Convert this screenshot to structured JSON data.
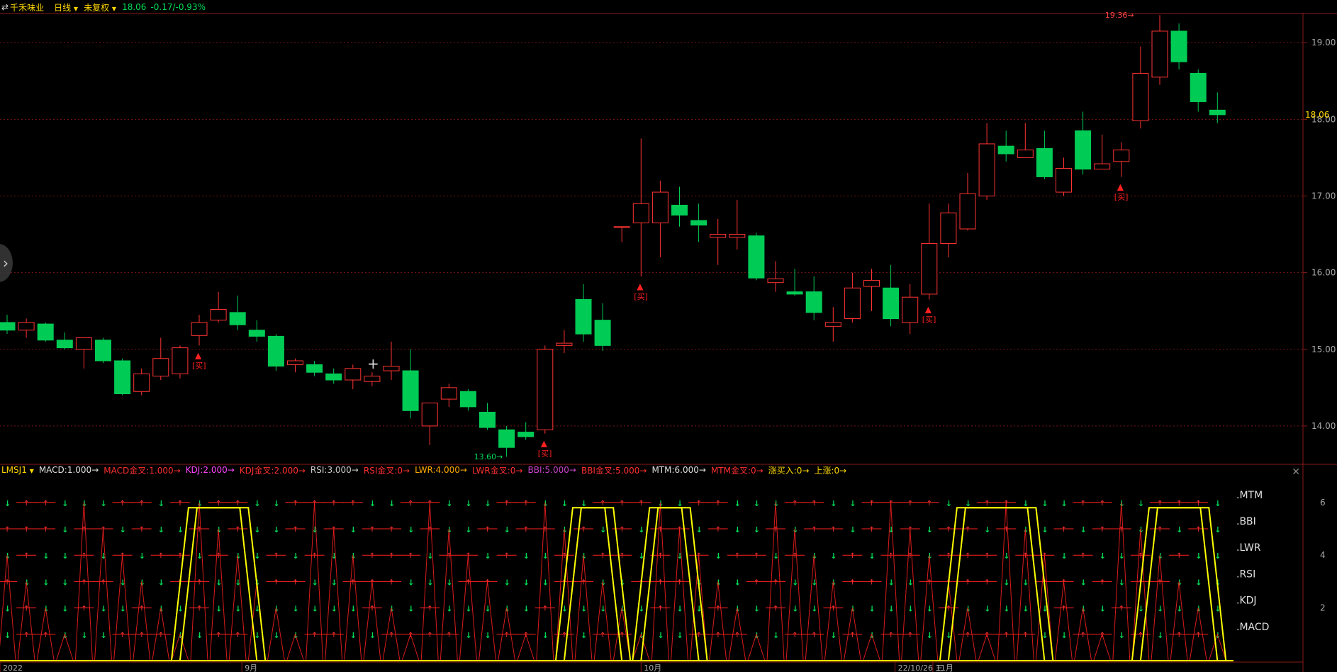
{
  "header": {
    "nav_icon": "reverse-arrows-icon",
    "stock_name": "千禾味业",
    "period": "日线",
    "adjust": "未复权",
    "price": "18.06",
    "change": "-0.17/-0.93%"
  },
  "indicator_bar": {
    "name": "LMSJ1",
    "items": [
      {
        "text": "MACD:1.000",
        "color": "#e0e0e0"
      },
      {
        "text": "MACD金叉:1.000",
        "color": "#ff3030"
      },
      {
        "text": "KDJ:2.000",
        "color": "#ff44ff"
      },
      {
        "text": "KDJ金叉:2.000",
        "color": "#ff3030"
      },
      {
        "text": "RSI:3.000",
        "color": "#cccccc"
      },
      {
        "text": "RSI金叉:0",
        "color": "#ff3030"
      },
      {
        "text": "LWR:4.000",
        "color": "#ffaa00"
      },
      {
        "text": "LWR金叉:0",
        "color": "#ff3030"
      },
      {
        "text": "BBI:5.000",
        "color": "#cc44cc"
      },
      {
        "text": "BBI金叉:5.000",
        "color": "#ff3030"
      },
      {
        "text": "MTM:6.000",
        "color": "#e0e0e0"
      },
      {
        "text": "MTM金叉:0",
        "color": "#ff3030"
      },
      {
        "text": "涨买入:0",
        "color": "#ffd700"
      },
      {
        "text": "上涨:0",
        "color": "#ffd700"
      }
    ],
    "close_icon": "close-icon"
  },
  "colors": {
    "up": "#ff3333",
    "down": "#00cc55",
    "yellow": "#ffff00",
    "grid": "#7a1515"
  },
  "price_axis": {
    "ticks": [
      "19.00",
      "18.00",
      "17.00",
      "16.00",
      "15.00",
      "14.00"
    ],
    "current": "18.06"
  },
  "osc_axis": {
    "ticks": [
      "6",
      "4",
      "2"
    ]
  },
  "series_labels": [
    ".MTM",
    ".BBI",
    ".LWR",
    ".RSI",
    ".KDJ",
    ".MACD"
  ],
  "buy_label": "[买]",
  "extremes": {
    "high": "19.36",
    "low": "13.60"
  },
  "x_labels": [
    "2022",
    "9月",
    "10月",
    "22/10/26 三",
    "11月"
  ],
  "chart_data": {
    "type": "candlestick",
    "ylim": [
      13.5,
      19.45
    ],
    "candles": [
      {
        "o": 15.35,
        "h": 15.45,
        "l": 15.2,
        "c": 15.25
      },
      {
        "o": 15.25,
        "h": 15.4,
        "l": 15.15,
        "c": 15.35
      },
      {
        "o": 15.33,
        "h": 15.35,
        "l": 15.1,
        "c": 15.12
      },
      {
        "o": 15.12,
        "h": 15.22,
        "l": 15.0,
        "c": 15.02
      },
      {
        "o": 15.0,
        "h": 15.15,
        "l": 14.75,
        "c": 15.15
      },
      {
        "o": 15.12,
        "h": 15.15,
        "l": 14.82,
        "c": 14.85
      },
      {
        "o": 14.85,
        "h": 14.88,
        "l": 14.4,
        "c": 14.42
      },
      {
        "o": 14.45,
        "h": 14.75,
        "l": 14.4,
        "c": 14.68
      },
      {
        "o": 14.65,
        "h": 15.15,
        "l": 14.6,
        "c": 14.88
      },
      {
        "o": 14.68,
        "h": 15.05,
        "l": 14.62,
        "c": 15.02
      },
      {
        "o": 15.18,
        "h": 15.45,
        "l": 15.05,
        "c": 15.35
      },
      {
        "o": 15.38,
        "h": 15.75,
        "l": 15.35,
        "c": 15.52
      },
      {
        "o": 15.48,
        "h": 15.7,
        "l": 15.25,
        "c": 15.32
      },
      {
        "o": 15.25,
        "h": 15.38,
        "l": 15.1,
        "c": 15.17
      },
      {
        "o": 15.17,
        "h": 15.2,
        "l": 14.72,
        "c": 14.78
      },
      {
        "o": 14.8,
        "h": 14.88,
        "l": 14.7,
        "c": 14.85
      },
      {
        "o": 14.8,
        "h": 14.85,
        "l": 14.65,
        "c": 14.7
      },
      {
        "o": 14.68,
        "h": 14.75,
        "l": 14.55,
        "c": 14.6
      },
      {
        "o": 14.6,
        "h": 14.8,
        "l": 14.48,
        "c": 14.75
      },
      {
        "o": 14.58,
        "h": 14.7,
        "l": 14.52,
        "c": 14.65
      },
      {
        "o": 14.72,
        "h": 15.1,
        "l": 14.6,
        "c": 14.78
      },
      {
        "o": 14.72,
        "h": 15.0,
        "l": 14.1,
        "c": 14.2
      },
      {
        "o": 14.0,
        "h": 14.3,
        "l": 13.75,
        "c": 14.3
      },
      {
        "o": 14.35,
        "h": 14.55,
        "l": 14.25,
        "c": 14.5
      },
      {
        "o": 14.45,
        "h": 14.48,
        "l": 14.2,
        "c": 14.25
      },
      {
        "o": 14.18,
        "h": 14.3,
        "l": 13.95,
        "c": 13.98
      },
      {
        "o": 13.95,
        "h": 14.0,
        "l": 13.6,
        "c": 13.72
      },
      {
        "o": 13.92,
        "h": 14.05,
        "l": 13.82,
        "c": 13.86
      },
      {
        "o": 13.95,
        "h": 15.05,
        "l": 13.9,
        "c": 15.0
      },
      {
        "o": 15.05,
        "h": 15.25,
        "l": 14.95,
        "c": 15.08
      },
      {
        "o": 15.65,
        "h": 15.85,
        "l": 15.1,
        "c": 15.2
      },
      {
        "o": 15.38,
        "h": 15.6,
        "l": 14.98,
        "c": 15.05
      },
      {
        "o": 16.6,
        "h": 16.6,
        "l": 16.4,
        "c": 16.6
      },
      {
        "o": 16.65,
        "h": 17.75,
        "l": 15.95,
        "c": 16.9
      },
      {
        "o": 16.65,
        "h": 17.2,
        "l": 16.2,
        "c": 17.05
      },
      {
        "o": 16.88,
        "h": 17.12,
        "l": 16.6,
        "c": 16.75
      },
      {
        "o": 16.68,
        "h": 16.9,
        "l": 16.4,
        "c": 16.62
      },
      {
        "o": 16.46,
        "h": 16.7,
        "l": 16.1,
        "c": 16.5
      },
      {
        "o": 16.46,
        "h": 16.95,
        "l": 16.3,
        "c": 16.5
      },
      {
        "o": 16.48,
        "h": 16.52,
        "l": 15.9,
        "c": 15.93
      },
      {
        "o": 15.87,
        "h": 16.15,
        "l": 15.75,
        "c": 15.92
      },
      {
        "o": 15.75,
        "h": 16.05,
        "l": 15.7,
        "c": 15.72
      },
      {
        "o": 15.75,
        "h": 15.95,
        "l": 15.38,
        "c": 15.48
      },
      {
        "o": 15.3,
        "h": 15.55,
        "l": 15.1,
        "c": 15.35
      },
      {
        "o": 15.4,
        "h": 16.0,
        "l": 15.35,
        "c": 15.8
      },
      {
        "o": 15.82,
        "h": 16.05,
        "l": 15.5,
        "c": 15.9
      },
      {
        "o": 15.8,
        "h": 16.1,
        "l": 15.3,
        "c": 15.4
      },
      {
        "o": 15.35,
        "h": 15.85,
        "l": 15.2,
        "c": 15.68
      },
      {
        "o": 15.72,
        "h": 16.9,
        "l": 15.65,
        "c": 16.38
      },
      {
        "o": 16.38,
        "h": 16.9,
        "l": 16.2,
        "c": 16.78
      },
      {
        "o": 16.57,
        "h": 17.3,
        "l": 16.55,
        "c": 17.03
      },
      {
        "o": 17.0,
        "h": 17.95,
        "l": 16.95,
        "c": 17.68
      },
      {
        "o": 17.65,
        "h": 17.85,
        "l": 17.45,
        "c": 17.55
      },
      {
        "o": 17.5,
        "h": 17.95,
        "l": 17.5,
        "c": 17.6
      },
      {
        "o": 17.62,
        "h": 17.85,
        "l": 17.22,
        "c": 17.25
      },
      {
        "o": 17.05,
        "h": 17.5,
        "l": 17.0,
        "c": 17.36
      },
      {
        "o": 17.85,
        "h": 18.1,
        "l": 17.28,
        "c": 17.35
      },
      {
        "o": 17.35,
        "h": 17.8,
        "l": 17.35,
        "c": 17.42
      },
      {
        "o": 17.45,
        "h": 17.7,
        "l": 17.25,
        "c": 17.6
      },
      {
        "o": 17.98,
        "h": 18.95,
        "l": 17.88,
        "c": 18.6
      },
      {
        "o": 18.55,
        "h": 19.36,
        "l": 18.45,
        "c": 19.15
      },
      {
        "o": 19.15,
        "h": 19.25,
        "l": 18.65,
        "c": 18.75
      },
      {
        "o": 18.6,
        "h": 18.65,
        "l": 18.1,
        "c": 18.23
      },
      {
        "o": 18.12,
        "h": 18.35,
        "l": 17.95,
        "c": 18.06
      }
    ]
  }
}
